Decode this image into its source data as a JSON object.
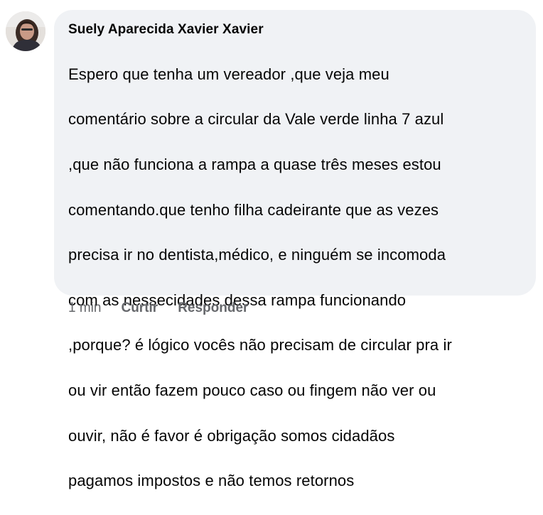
{
  "comment": {
    "author": "Suely Aparecida Xavier Xavier",
    "avatar_icon": "user-photo-avatar",
    "lines": [
      "Espero que tenha um vereador ,que veja meu",
      "comentário sobre a circular da Vale verde linha 7 azul",
      ",que não funciona a rampa a quase três meses estou",
      "comentando.que tenho filha cadeirante que as vezes",
      "precisa ir no dentista,médico, e ninguém se incomoda",
      "com as nessecidades dessa rampa funcionando",
      ",porque? é lógico vocês não precisam de circular pra ir",
      "ou vir então fazem pouco caso ou fingem não ver ou",
      "ouvir, não é favor é obrigação somos cidadãos",
      "pagamos impostos e não temos retornos"
    ]
  },
  "actions": {
    "time": "1 min",
    "like_label": "Curtir",
    "reply_label": "Responder"
  },
  "colors": {
    "bubble_bg": "#f0f2f5",
    "text": "#050505",
    "secondary_text": "#65676b"
  }
}
